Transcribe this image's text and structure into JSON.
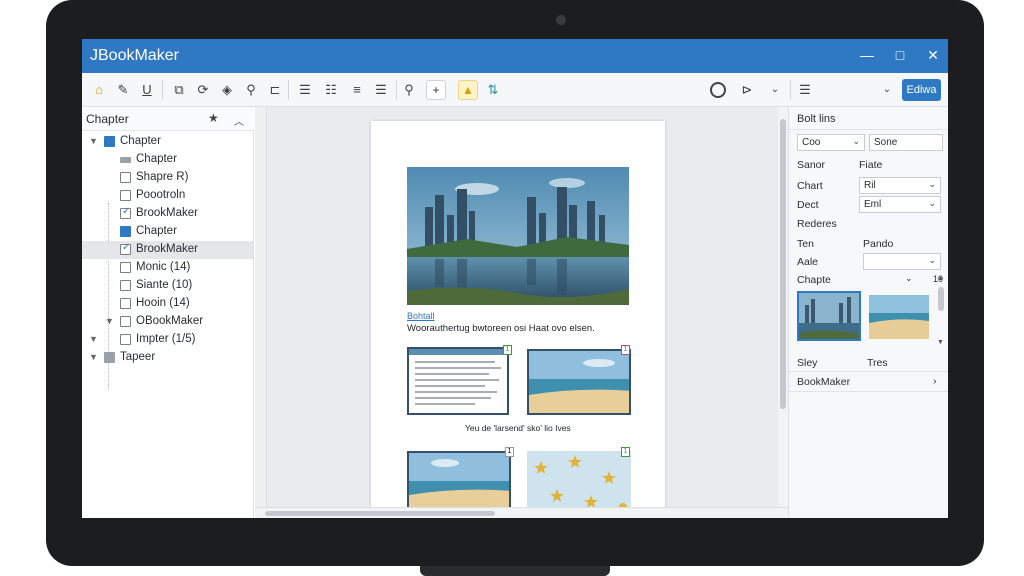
{
  "app": {
    "title": "JBookMaker"
  },
  "window_controls": {
    "minimize": "—",
    "maximize": "□",
    "close": "✕"
  },
  "toolbar": {
    "primary_label": "Ediwa",
    "box_plus": "+"
  },
  "left_panel": {
    "title": "Chapter",
    "items": [
      {
        "label": "Chapter"
      },
      {
        "label": "Chapter"
      },
      {
        "label": "Shapre R)"
      },
      {
        "label": "Poootroln"
      },
      {
        "label": "BrookMaker"
      },
      {
        "label": "Chapter"
      },
      {
        "label": "BrookMaker"
      },
      {
        "label": "Monic (14)"
      },
      {
        "label": "Siante (10)"
      },
      {
        "label": "Hooin (14)"
      },
      {
        "label": "OBookMaker"
      },
      {
        "label": "Impter (1/5)"
      },
      {
        "label": "Tapeer"
      }
    ]
  },
  "canvas": {
    "image_link": "Bohtall",
    "image_caption": "Woorauthertug bwtoreen osi Haat ovo elsen.",
    "grid_caption": "Yeu de 'larsend' sko' lio Ives",
    "badges": [
      "1",
      "1",
      "1",
      "1"
    ]
  },
  "right_panel": {
    "title": "Bolt lins",
    "dropdown1": "Coo",
    "field1": "Sone",
    "label_sanor": "Sanor",
    "label_fiate": "Fiate",
    "label_chart": "Chart",
    "chart_value": "Ril",
    "label_dect": "Dect",
    "dect_value": "Eml",
    "label_rederes": "Rederes",
    "label_ten": "Ten",
    "label_pando": "Pando",
    "label_aale": "Aale",
    "label_chapte": "Chapte",
    "chapte_count": "10",
    "label_sley": "Sley",
    "label_tres": "Tres",
    "bookmaker_label": "BookMaker"
  },
  "colors": {
    "accent": "#2f78c4",
    "bezel": "#1c1d1f",
    "canvas_bg": "#e9ebee"
  }
}
